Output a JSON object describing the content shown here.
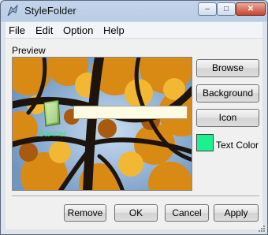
{
  "window": {
    "title": "StyleFolder"
  },
  "titlebar_buttons": {
    "minimize_glyph": "–",
    "maximize_glyph": "□",
    "close_glyph": "✕"
  },
  "menu": [
    {
      "label": "File"
    },
    {
      "label": "Edit"
    },
    {
      "label": "Option"
    },
    {
      "label": "Help"
    }
  ],
  "preview": {
    "label": "Preview",
    "banner_label": "Banner",
    "banner_text": "",
    "banner_text_color": "#3fe07a"
  },
  "side_buttons": {
    "browse": "Browse",
    "background": "Background",
    "icon": "Icon"
  },
  "text_color": {
    "label": "Text Color",
    "swatch_color": "#1cf091"
  },
  "footer_buttons": {
    "remove": "Remove",
    "ok": "OK",
    "cancel": "Cancel",
    "apply": "Apply"
  },
  "icons": {
    "app": "stylefolder-app-icon",
    "banner": "folder-icon",
    "grip": "resize-grip-icon"
  }
}
